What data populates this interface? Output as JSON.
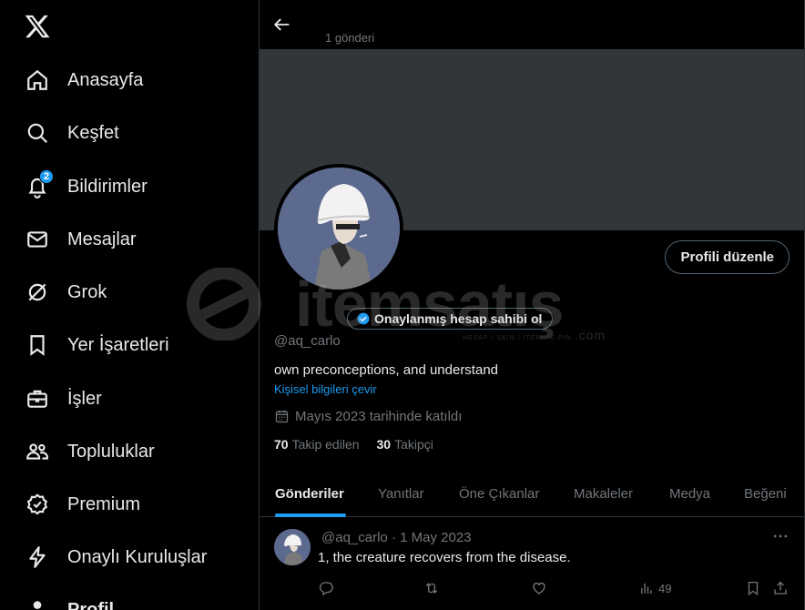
{
  "sidebar": {
    "logo": "x-logo-icon",
    "items": [
      {
        "label": "Anasayfa",
        "icon": "home-icon"
      },
      {
        "label": "Keşfet",
        "icon": "search-icon"
      },
      {
        "label": "Bildirimler",
        "icon": "bell-icon",
        "badge": "2"
      },
      {
        "label": "Mesajlar",
        "icon": "mail-icon"
      },
      {
        "label": "Grok",
        "icon": "grok-icon"
      },
      {
        "label": "Yer İşaretleri",
        "icon": "bookmark-icon"
      },
      {
        "label": "İşler",
        "icon": "briefcase-icon"
      },
      {
        "label": "Topluluklar",
        "icon": "communities-icon"
      },
      {
        "label": "Premium",
        "icon": "premium-icon"
      },
      {
        "label": "Onaylı Kuruluşlar",
        "icon": "lightning-icon"
      },
      {
        "label": "Profil",
        "icon": "profile-icon"
      }
    ]
  },
  "header": {
    "post_count": "1 gönderi"
  },
  "profile": {
    "edit_button": "Profili düzenle",
    "verify_pill": "Onaylanmış hesap sahibi ol",
    "handle": "@aq_carlo",
    "bio": "own preconceptions, and understand",
    "translate_link": "Kişisel bilgileri çevir",
    "joined": "Mayıs 2023 tarihinde katıldı",
    "following_count": "70",
    "following_label": "Takip edilen",
    "followers_count": "30",
    "followers_label": "Takipçi"
  },
  "tabs": [
    {
      "label": "Gönderiler",
      "active": true
    },
    {
      "label": "Yanıtlar"
    },
    {
      "label": "Öne Çıkanlar"
    },
    {
      "label": "Makaleler"
    },
    {
      "label": "Medya"
    },
    {
      "label": "Beğeni"
    }
  ],
  "tweet": {
    "handle": "@aq_carlo",
    "separator": "·",
    "date": "1 May 2023",
    "text": "1, the creature recovers from the disease.",
    "views": "49"
  },
  "watermark": {
    "text": "itemsatış",
    "sub": "HESAP / SKIN / İTEM / E-PIN",
    "domain": ".com"
  },
  "colors": {
    "accent": "#1d9bf0",
    "background": "#000000",
    "banner": "#333639",
    "secondary_text": "#71767b",
    "border": "#2f3336"
  }
}
